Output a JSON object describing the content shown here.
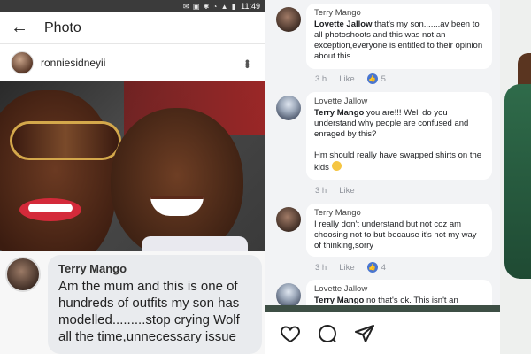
{
  "status_bar": {
    "time": "11:49"
  },
  "left_app": {
    "title": "Photo",
    "username": "ronniesidneyii",
    "quoted_comment": {
      "author": "Terry Mango",
      "text": "Am the mum and this is one of hundreds of outfits my son has modelled.........stop crying Wolf all the time,unnecessary issue"
    }
  },
  "comments": [
    {
      "author": "Terry Mango",
      "mention": "Lovette Jallow",
      "text": " that's my son.......av been to all photoshoots and this was not an exception,everyone is entitled to their opinion about this.",
      "time": "3 h",
      "like_label": "Like",
      "reactions": "5"
    },
    {
      "author": "Lovette Jallow",
      "mention": "Terry Mango",
      "text": " you are!!! Well do you understand why people are confused and enraged by this?",
      "text2": "Hm should really have swapped shirts on the kids",
      "time": "3 h",
      "like_label": "Like"
    },
    {
      "author": "Terry Mango",
      "text": "I really don't understand but not coz am choosing not to but because it's not my way of thinking,sorry",
      "time": "3 h",
      "like_label": "Like",
      "reactions": "4"
    },
    {
      "author": "Lovette Jallow",
      "mention": "Terry Mango",
      "text": " no that's ok. This isn't an"
    }
  ],
  "colors": {
    "like_blue": "#4a76d0",
    "divider_green": "#3e4f45",
    "comment_bg": "#f2f3f5"
  },
  "icons": {
    "back": "arrow-left-icon",
    "more": "more-vertical-icon",
    "heart": "heart-icon",
    "comment": "comment-icon",
    "share": "send-icon"
  }
}
